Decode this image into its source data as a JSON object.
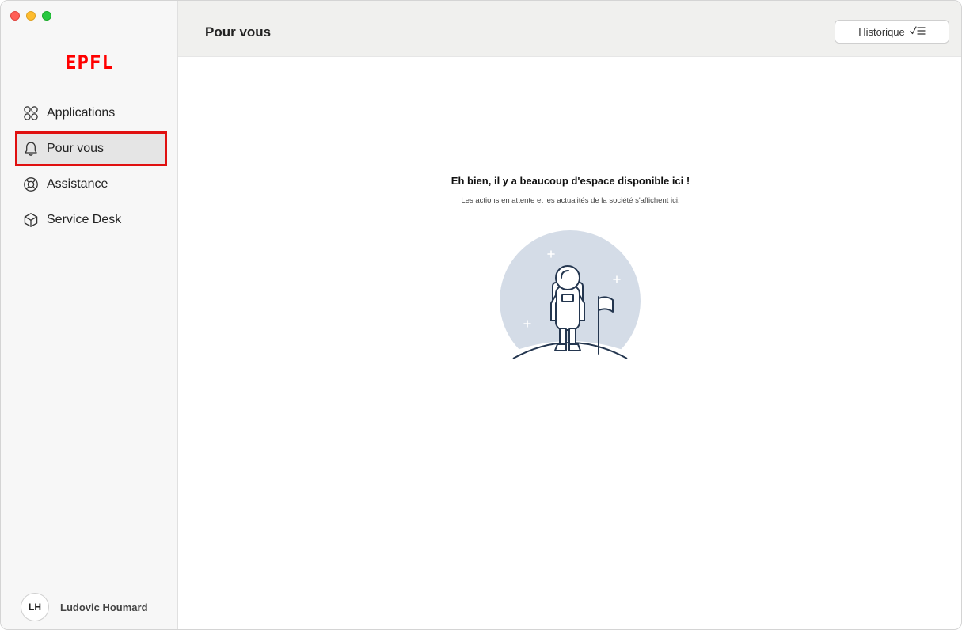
{
  "brand": {
    "logo_text": "EPFL",
    "logo_color": "#ff0000"
  },
  "sidebar": {
    "items": [
      {
        "label": "Applications",
        "icon": "apps-grid-icon"
      },
      {
        "label": "Pour vous",
        "icon": "bell-icon",
        "active": true
      },
      {
        "label": "Assistance",
        "icon": "lifebuoy-icon"
      },
      {
        "label": "Service Desk",
        "icon": "cube-icon"
      }
    ],
    "highlight_color": "#e01010"
  },
  "user": {
    "initials": "LH",
    "name": "Ludovic Houmard"
  },
  "header": {
    "title": "Pour vous",
    "history_label": "Historique",
    "history_icon": "checklist-icon"
  },
  "empty_state": {
    "title": "Eh bien, il y a beaucoup d'espace disponible ici !",
    "subtitle": "Les actions en attente et les actualités de la société s'affichent ici.",
    "illustration": "astronaut-icon"
  }
}
